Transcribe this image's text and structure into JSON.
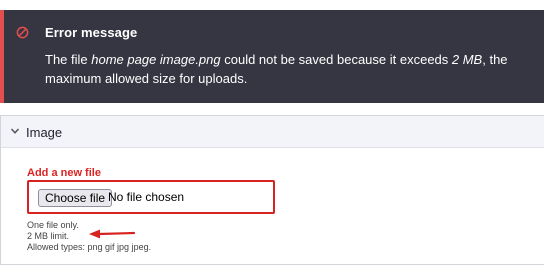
{
  "error": {
    "title": "Error message",
    "text_prefix": "The file ",
    "filename": "home page image.png",
    "text_middle": " could not be saved because it exceeds ",
    "limit": "2 MB",
    "text_suffix": ", the maximum allowed size for uploads.",
    "icon": "error-circle-slash-icon",
    "accent_color": "#e34f4f",
    "background_color": "#353641"
  },
  "details": {
    "summary_label": "Image",
    "expanded": true,
    "field": {
      "label": "Add a new file",
      "button_label": "Choose file",
      "status": "No file chosen",
      "error_color": "#d72222"
    },
    "help": {
      "line1": "One file only.",
      "line2": "2 MB limit.",
      "line3": "Allowed types: png gif jpg jpeg."
    },
    "annotation_arrow_color": "#d72222"
  }
}
